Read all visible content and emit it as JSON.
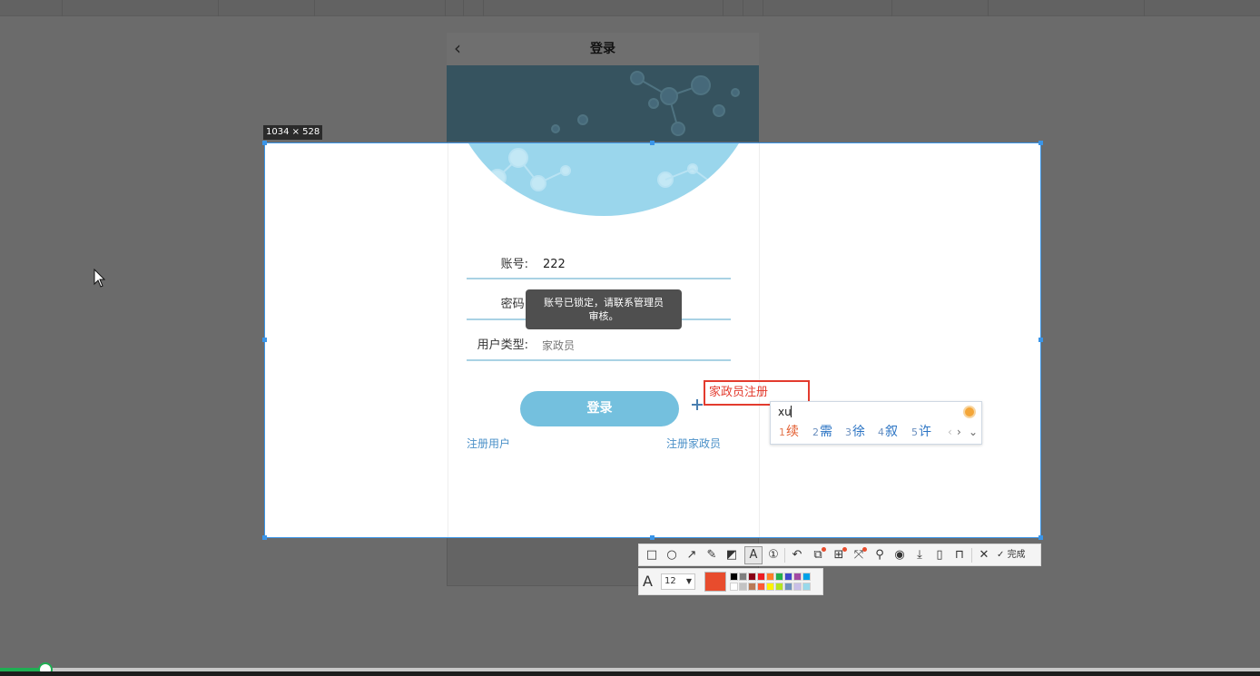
{
  "phone": {
    "header_title": "登录",
    "back_glyph": "‹"
  },
  "capture": {
    "size_label": "1034 × 528"
  },
  "form": {
    "account_label": "账号:",
    "account_value": "222",
    "password_label": "密码:",
    "user_type_label": "用户类型:",
    "user_type_value": "家政员",
    "login_button": "登录",
    "register_user_link": "注册用户",
    "register_worker_link": "注册家政员"
  },
  "toast": {
    "line1": "账号已锁定，请联系管理员",
    "line2": "审核。"
  },
  "annotation": {
    "text": "家政员注册"
  },
  "ime": {
    "input_text": "xu",
    "candidates": [
      {
        "num": "1",
        "char": "续"
      },
      {
        "num": "2",
        "char": "需"
      },
      {
        "num": "3",
        "char": "徐"
      },
      {
        "num": "4",
        "char": "叙"
      },
      {
        "num": "5",
        "char": "许"
      }
    ],
    "nav_prev": "‹",
    "nav_next": "›",
    "nav_expand": "⌄"
  },
  "toolbar": {
    "done_label": "完成",
    "font_size": "12",
    "current_color": "#e84c2d",
    "palette": [
      "#000000",
      "#7f7f7f",
      "#880015",
      "#ed1c24",
      "#ff7f27",
      "#22b14c",
      "#3f48cc",
      "#a349a4",
      "#00a2e8",
      "#ffffff",
      "#c3c3c3",
      "#b97a57",
      "#ff5a36",
      "#fff200",
      "#b5e61d",
      "#7092be",
      "#c8bfe7",
      "#99d9ea"
    ]
  },
  "colors": {
    "selection_border": "#3a95e8",
    "progress": "#1fae53",
    "annotation": "#e33b2e"
  },
  "progress": {
    "position_fraction": 0.036
  }
}
